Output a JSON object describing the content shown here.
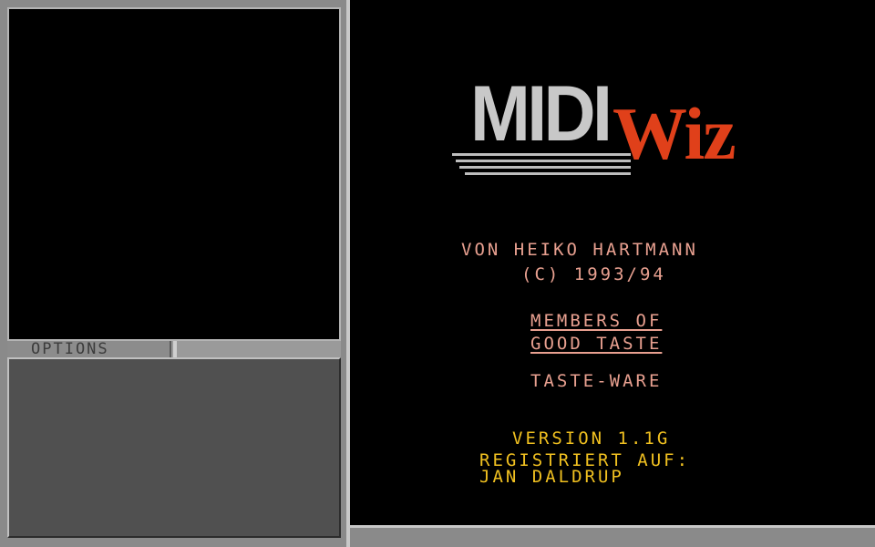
{
  "options": {
    "tab_label": "OPTIONS"
  },
  "logo": {
    "midi": "MIDI",
    "wiz": "Wiz"
  },
  "credits": {
    "author": "VON HEIKO HARTMANN",
    "copyright": "(C) 1993/94",
    "group_line1": "MEMBERS OF",
    "group_line2": "GOOD TASTE",
    "label": "TASTE-WARE"
  },
  "registration": {
    "version": "VERSION 1.1G",
    "registered_label": "REGISTRIERT AUF:",
    "registered_name": "JAN DALDRUP"
  },
  "colors": {
    "accent_red": "#e0401a",
    "credit_text": "#e8a090",
    "version_text": "#f0c020",
    "frame_gray": "#8a8a8a"
  }
}
